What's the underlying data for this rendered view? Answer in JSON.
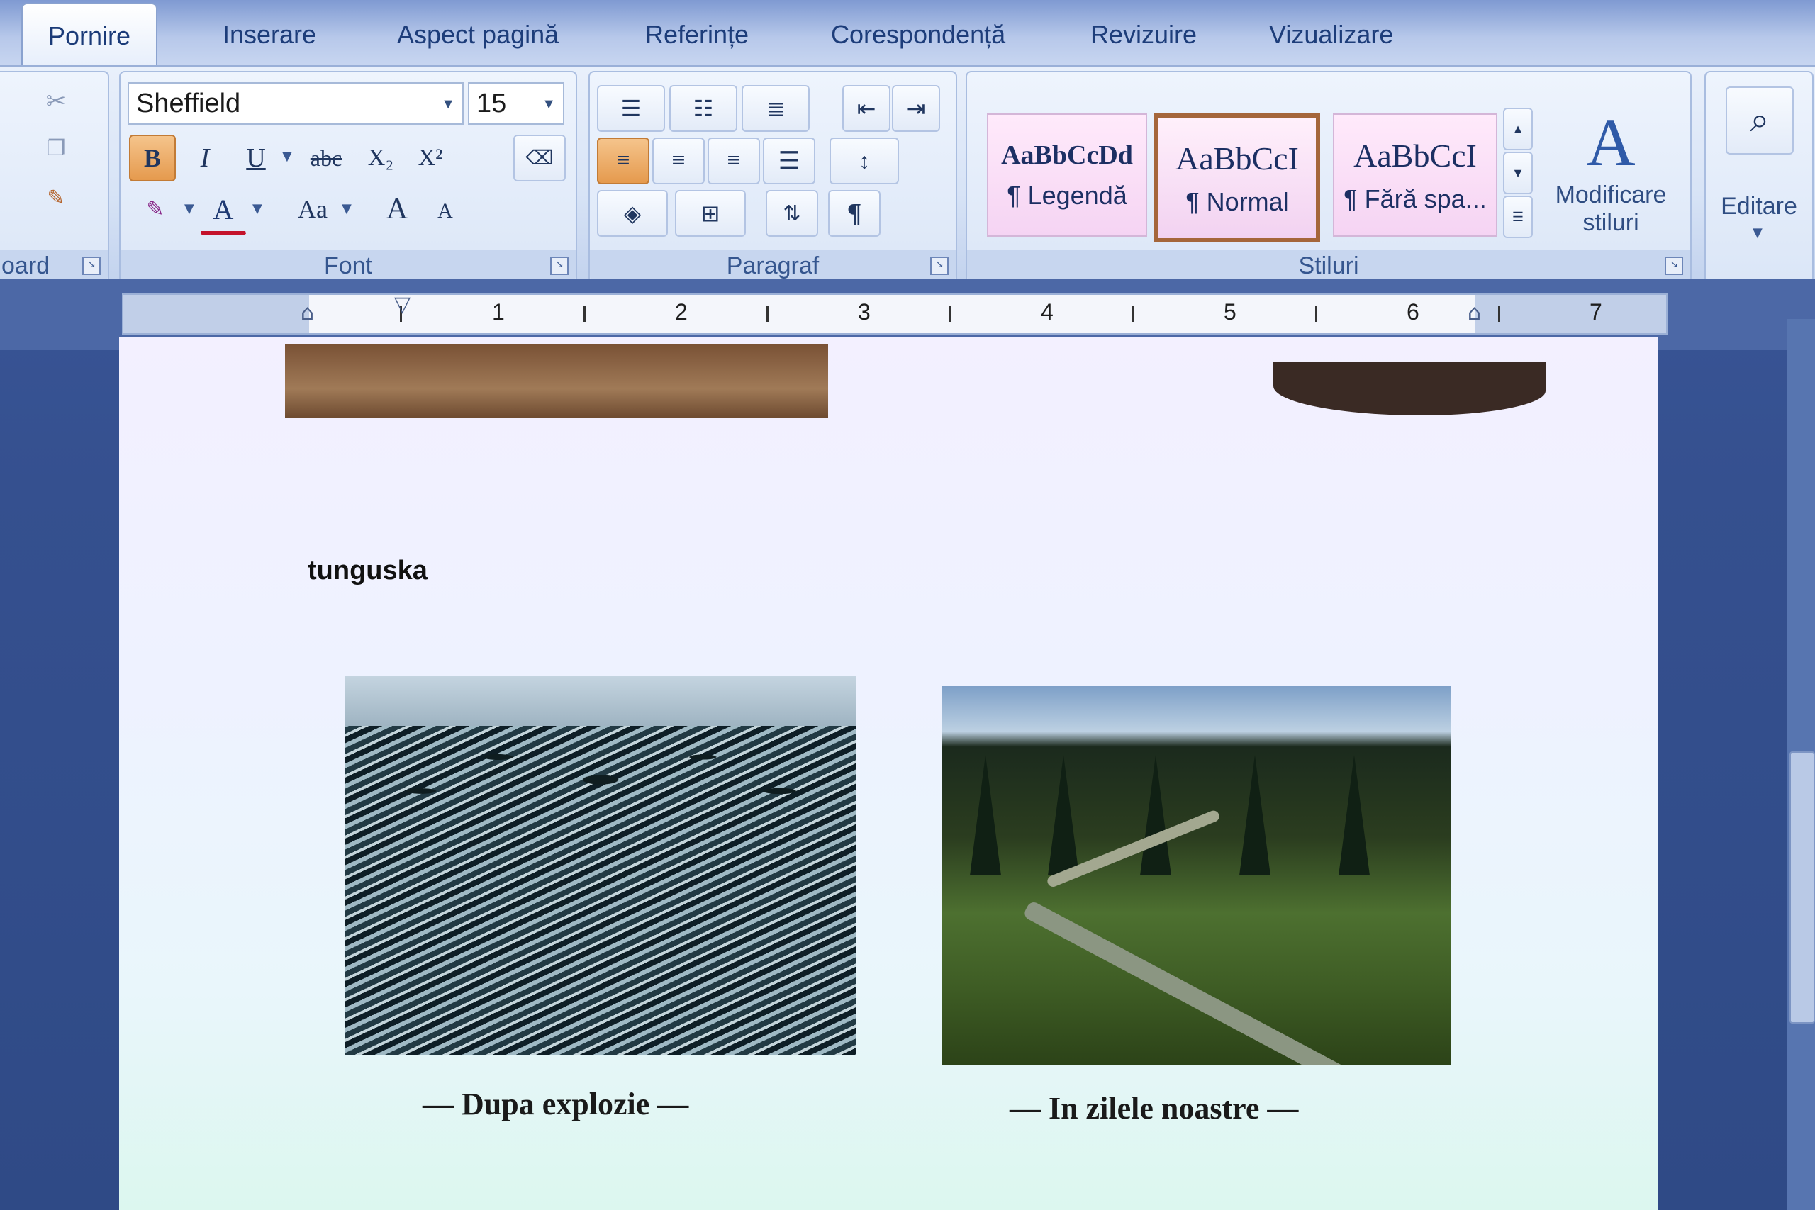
{
  "tabs": [
    {
      "label": "Pornire",
      "active": true
    },
    {
      "label": "Inserare"
    },
    {
      "label": "Aspect pagină"
    },
    {
      "label": "Referințe"
    },
    {
      "label": "Corespondență"
    },
    {
      "label": "Revizuire"
    },
    {
      "label": "Vizualizare"
    }
  ],
  "clipboard": {
    "label": "oard"
  },
  "font_group": {
    "label": "Font",
    "font_name": "Sheffield",
    "font_size": "15",
    "bold": "B",
    "italic": "I",
    "underline": "U",
    "strikethrough": "abc",
    "subscript": "X₂",
    "superscript": "X²",
    "change_case": "Aa",
    "grow_font": "A",
    "shrink_font": "A",
    "font_color": "A"
  },
  "paragraph_group": {
    "label": "Paragraf",
    "show_marks": "¶"
  },
  "styles_group": {
    "label": "Stiluri",
    "styles": [
      {
        "sample": "AaBbCcDd",
        "name": "¶ Legendă"
      },
      {
        "sample": "AaBbCcI",
        "name": "¶ Normal",
        "selected": true
      },
      {
        "sample": "AaBbCcI",
        "name": "¶ Fără spa..."
      }
    ],
    "change_styles": "Modificare stiluri"
  },
  "editing": {
    "label": "Editare"
  },
  "ruler": {
    "numbers": [
      "1",
      "2",
      "3",
      "4",
      "5",
      "6",
      "7"
    ]
  },
  "document": {
    "heading": "tunguska",
    "captions": [
      "— Dupa explozie —",
      "— In zilele noastre —"
    ]
  }
}
